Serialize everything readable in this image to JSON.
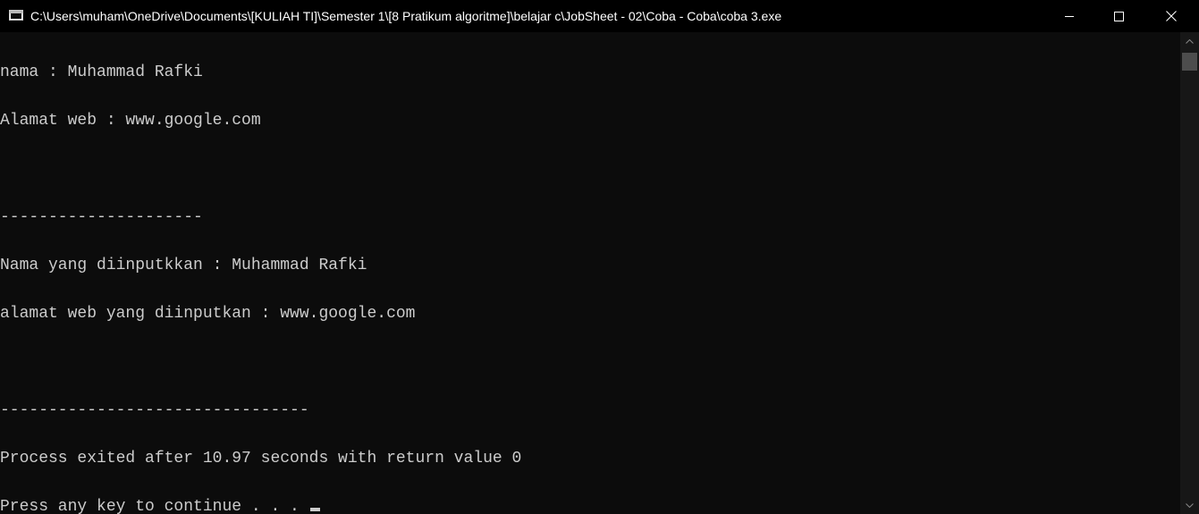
{
  "window": {
    "title": "C:\\Users\\muham\\OneDrive\\Documents\\[KULIAH TI]\\Semester 1\\[8 Pratikum algoritme]\\belajar c\\JobSheet - 02\\Coba - Coba\\coba 3.exe",
    "icon": "console-window-icon",
    "controls": {
      "minimize": "minimize-icon",
      "maximize": "maximize-icon",
      "close": "close-icon"
    }
  },
  "console": {
    "lines": [
      "nama : Muhammad Rafki",
      "Alamat web : www.google.com",
      "",
      "---------------------",
      "Nama yang diinputkkan : Muhammad Rafki",
      "alamat web yang diinputkan : www.google.com",
      "",
      "--------------------------------",
      "Process exited after 10.97 seconds with return value 0",
      "Press any key to continue . . . "
    ]
  },
  "colors": {
    "background": "#0c0c0c",
    "titlebar": "#000000",
    "text": "#cccccc",
    "title_text": "#ffffff"
  }
}
